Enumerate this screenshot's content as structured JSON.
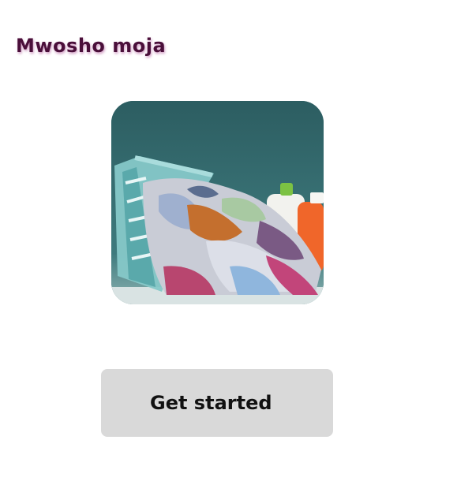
{
  "app": {
    "title": "Mwosho moja"
  },
  "hero": {
    "icon": "laundry-basket-image"
  },
  "actions": {
    "get_started_label": "Get started"
  },
  "colors": {
    "title": "#4a0f3a",
    "button_background": "#d9d9d9",
    "hero_background": "#2f6366"
  }
}
